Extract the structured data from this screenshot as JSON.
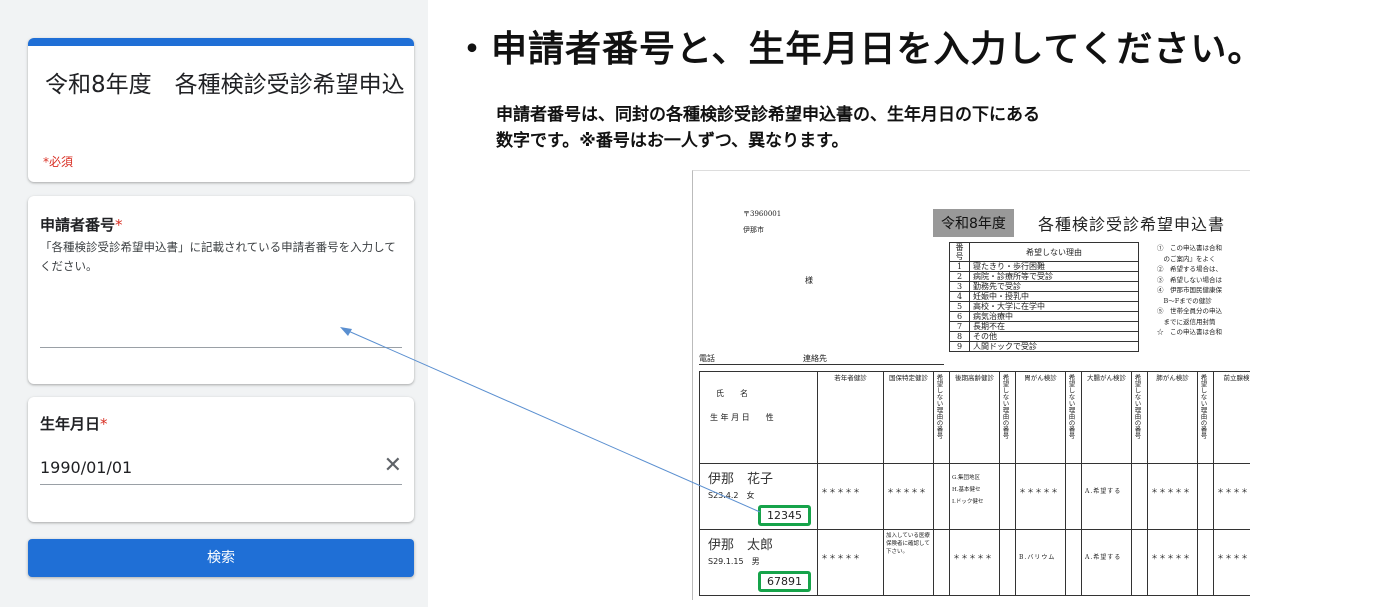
{
  "form": {
    "title": "令和8年度　各種検診受診希望申込",
    "required_note": "*必須",
    "applicant": {
      "label": "申請者番号",
      "star": "*",
      "description": "「各種検診受診希望申込書」に記載されている申請者番号を入力してください。",
      "value": ""
    },
    "dob": {
      "label": "生年月日",
      "star": "*",
      "value": "1990/01/01",
      "clear_icon": "close-icon"
    },
    "search_label": "検索"
  },
  "instructions": {
    "heading": "・申請者番号と、生年月日を入力してください。",
    "line1": "申請者番号は、同封の各種検診受診希望申込書の、生年月日の下にある",
    "line2": "数字です。※番号はお一人ずつ、異なります。"
  },
  "document": {
    "zip": "〒3960001",
    "city": "伊那市",
    "sama": "様",
    "year_label": "令和8年度",
    "title": "各種検診受診希望申込書",
    "reason_header": [
      "番号",
      "希望しない理由"
    ],
    "reasons": [
      [
        "1",
        "寝たきり・歩行困難"
      ],
      [
        "2",
        "病院・診療所等で受診"
      ],
      [
        "3",
        "勤務先で受診"
      ],
      [
        "4",
        "妊娠中・授乳中"
      ],
      [
        "5",
        "高校・大学に在学中"
      ],
      [
        "6",
        "病気治療中"
      ],
      [
        "7",
        "長期不在"
      ],
      [
        "8",
        "その他"
      ],
      [
        "9",
        "人間ドックで受診"
      ]
    ],
    "notes": [
      "①　この申込書は合和",
      "　のご案内』をよく",
      "②　希望する場合は、",
      "③　希望しない場合は",
      "④　伊那市国民健康保",
      "　B～Fまでの健診",
      "⑤　世帯全員分の申込",
      "　までに返信用封筒",
      "☆　この申込書は合和"
    ],
    "tel": "電話",
    "contact": "連絡先",
    "name_header": "氏　　名",
    "dob_header": "生 年 月 日　　性",
    "columns": [
      "若年者健診",
      "国保特定健診",
      "後期高齢健診",
      "胃がん検診",
      "大腸がん検診",
      "肺がん検診",
      "前立腺検"
    ],
    "reason_vertical": "希望しない理由の番号",
    "stars": "＊＊＊＊＊",
    "persons": [
      {
        "name": "伊那　花子",
        "dob": "S23.4.2",
        "sex": "女",
        "number": "12345",
        "kokuho": "＊＊＊＊＊",
        "koki_opts": [
          "G.集団地区",
          "H.基本健セ",
          "I.ドック健セ"
        ],
        "igan": "＊＊＊＊＊",
        "daicho": "A.希望する"
      },
      {
        "name": "伊那　太郎",
        "dob": "S29.1.15",
        "sex": "男",
        "number": "67891",
        "kokuho_note": "加入している医療保険者に確認して下さい。",
        "koki": "＊＊＊＊＊",
        "igan": "B.バリウム",
        "daicho": "A.希望する"
      }
    ]
  }
}
